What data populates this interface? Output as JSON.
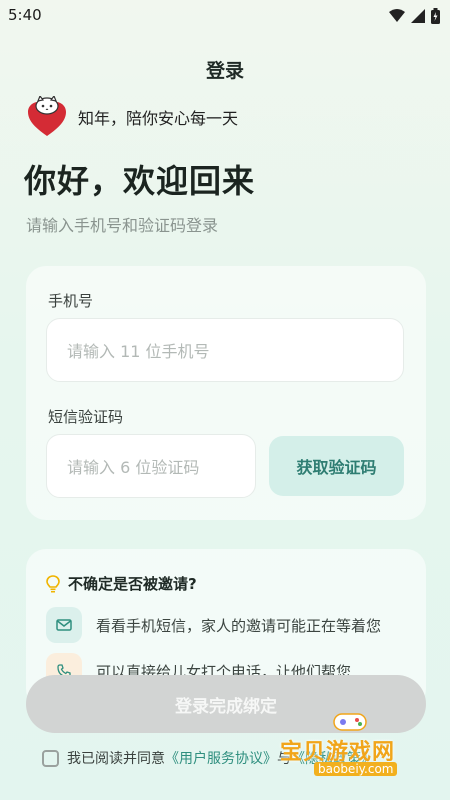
{
  "status": {
    "time": "5:40"
  },
  "header": {
    "title": "登录"
  },
  "brand": {
    "tagline": "知年，陪你安心每一天"
  },
  "greeting": "你好，欢迎回来",
  "subtitle": "请输入手机号和验证码登录",
  "form": {
    "phone_label": "手机号",
    "phone_placeholder": "请输入 11 位手机号",
    "code_label": "短信验证码",
    "code_placeholder": "请输入 6 位验证码",
    "get_code_label": "获取验证码"
  },
  "tips": {
    "title": "不确定是否被邀请?",
    "items": [
      {
        "icon": "mail-icon",
        "text": "看看手机短信，家人的邀请可能正在等着您"
      },
      {
        "icon": "phone-icon",
        "text": "可以直接给儿女打个电话，让他们帮您"
      }
    ]
  },
  "submit_label": "登录完成绑定",
  "agreement": {
    "prefix": "我已阅读并同意",
    "service": "《用户服务协议》",
    "conj": "与",
    "privacy": "《隐私政策》"
  },
  "watermark": {
    "title": "宝贝游戏网",
    "url": "baobeiy.com"
  },
  "colors": {
    "accent": "#2f8f7f",
    "button_disabled": "#d2d4d3",
    "logo_heart": "#d42b35"
  }
}
